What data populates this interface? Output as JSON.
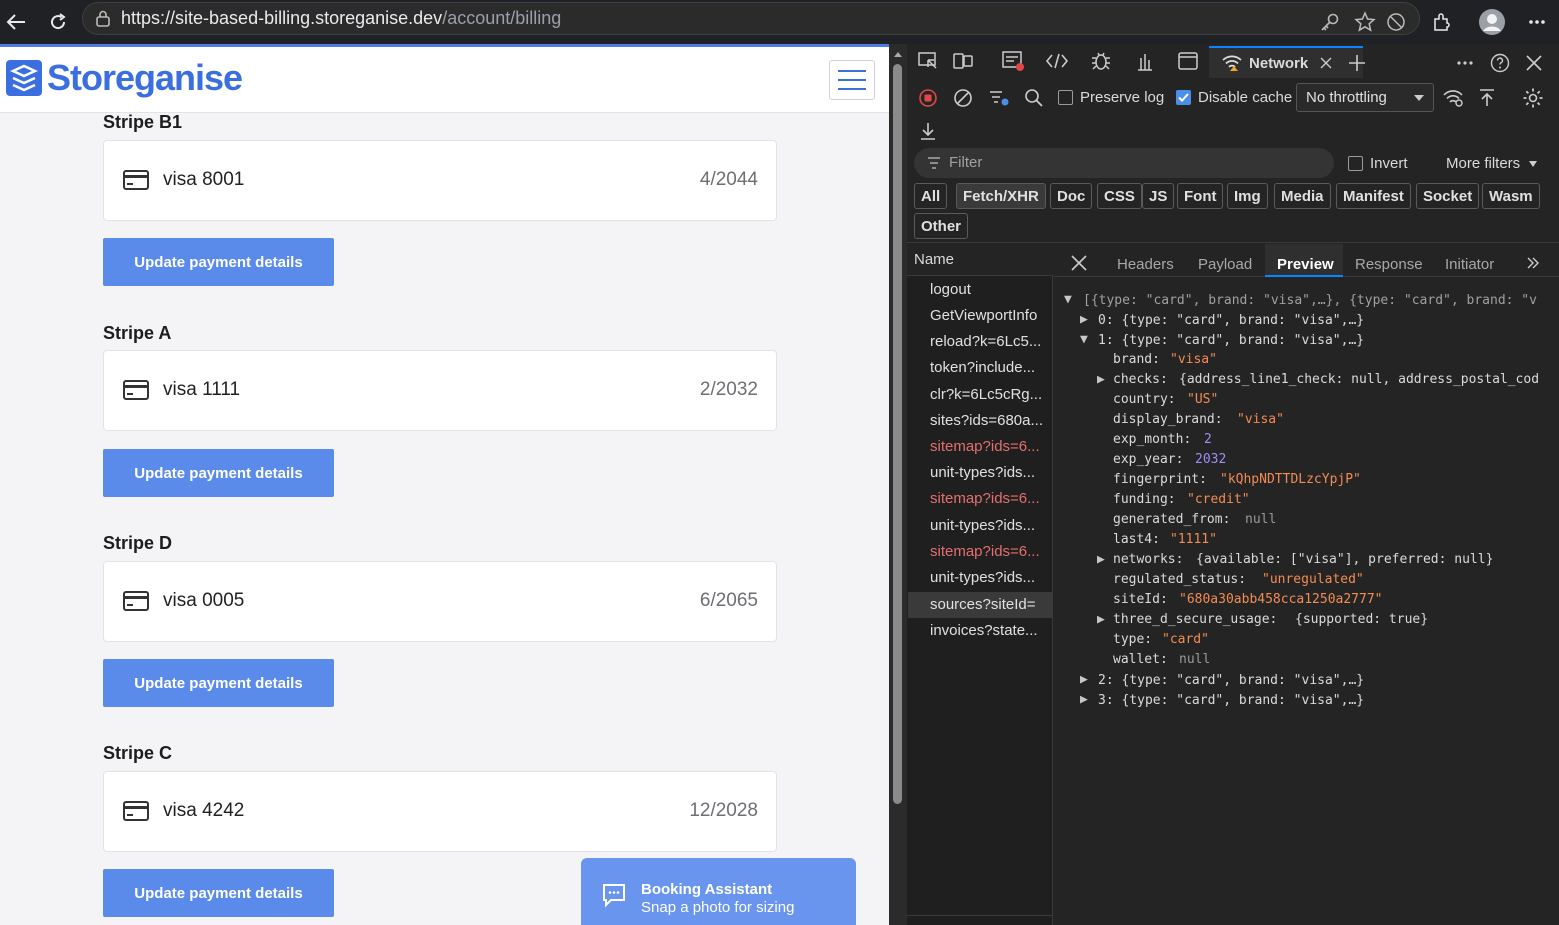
{
  "browser": {
    "url_host": "https://site-based-billing.storeganise.dev",
    "url_path": "/account/billing"
  },
  "site": {
    "logo_text": "Storeganise",
    "sections": [
      {
        "title": "Stripe B1",
        "card_brand": "visa 8001",
        "card_exp": "4/2044",
        "button": "Update payment details"
      },
      {
        "title": "Stripe A",
        "card_brand": "visa 1111",
        "card_exp": "2/2032",
        "button": "Update payment details"
      },
      {
        "title": "Stripe D",
        "card_brand": "visa 0005",
        "card_exp": "6/2065",
        "button": "Update payment details"
      },
      {
        "title": "Stripe C",
        "card_brand": "visa 4242",
        "card_exp": "12/2028",
        "button": "Update payment details"
      }
    ],
    "chat": {
      "title": "Booking Assistant",
      "subtitle": "Snap a photo for sizing"
    }
  },
  "devtools": {
    "active_tab": "Network",
    "preserve_log": "Preserve log",
    "disable_cache": "Disable cache",
    "throttling": "No throttling",
    "filter_placeholder": "Filter",
    "invert": "Invert",
    "more_filters": "More filters",
    "type_filters": [
      "All",
      "Fetch/XHR",
      "Doc",
      "CSS",
      "JS",
      "Font",
      "Img",
      "Media",
      "Manifest",
      "Socket",
      "Wasm",
      "Other"
    ],
    "name_header": "Name",
    "requests": [
      {
        "name": "logout",
        "error": false
      },
      {
        "name": "GetViewportInfo",
        "error": false
      },
      {
        "name": "reload?k=6Lc5...",
        "error": false
      },
      {
        "name": "token?include...",
        "error": false
      },
      {
        "name": "clr?k=6Lc5cRg...",
        "error": false
      },
      {
        "name": "sites?ids=680a...",
        "error": false
      },
      {
        "name": "sitemap?ids=6...",
        "error": true
      },
      {
        "name": "unit-types?ids...",
        "error": false
      },
      {
        "name": "sitemap?ids=6...",
        "error": true
      },
      {
        "name": "unit-types?ids...",
        "error": false
      },
      {
        "name": "sitemap?ids=6...",
        "error": true
      },
      {
        "name": "unit-types?ids...",
        "error": false
      },
      {
        "name": "sources?siteId=",
        "error": false
      },
      {
        "name": "invoices?state...",
        "error": false
      }
    ],
    "detail_tabs": [
      "Headers",
      "Payload",
      "Preview",
      "Response",
      "Initiator"
    ],
    "active_detail_tab": "Preview",
    "preview": {
      "root": "[{type: \"card\", brand: \"visa\",…}, {type: \"card\", brand: \"v",
      "item0": "0: {type: \"card\", brand: \"visa\",…}",
      "item1": "1: {type: \"card\", brand: \"visa\",…}",
      "fields": {
        "brand": "\"visa\"",
        "checks": "{address_line1_check: null, address_postal_cod",
        "country": "\"US\"",
        "display_brand": "\"visa\"",
        "exp_month": "2",
        "exp_year": "2032",
        "fingerprint": "\"kQhpNDTTDLzcYpjP\"",
        "funding": "\"credit\"",
        "generated_from": "null",
        "last4": "\"1111\"",
        "networks": "{available: [\"visa\"], preferred: null}",
        "regulated_status": "\"unregulated\"",
        "siteId": "\"680a30abb458cca1250a2777\"",
        "three_d_secure_usage": "{supported: true}",
        "type": "\"card\"",
        "wallet": "null"
      },
      "item2": "2: {type: \"card\", brand: \"visa\",…}",
      "item3": "3: {type: \"card\", brand: \"visa\",…}"
    }
  }
}
